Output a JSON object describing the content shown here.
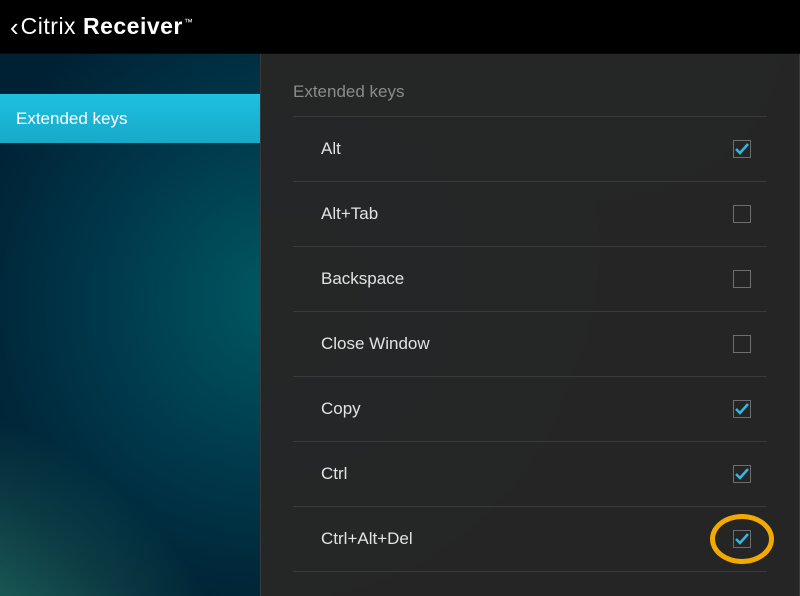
{
  "topbar": {
    "brand_light": "Citrix ",
    "brand_heavy": "Receiver",
    "trademark": "™"
  },
  "sidebar": {
    "items": [
      {
        "label": "Extended keys",
        "active": true
      }
    ]
  },
  "panel": {
    "section_title": "Extended keys",
    "rows": [
      {
        "label": "Alt",
        "checked": true
      },
      {
        "label": "Alt+Tab",
        "checked": false
      },
      {
        "label": "Backspace",
        "checked": false
      },
      {
        "label": "Close Window",
        "checked": false
      },
      {
        "label": "Copy",
        "checked": true
      },
      {
        "label": "Ctrl",
        "checked": true
      },
      {
        "label": "Ctrl+Alt+Del",
        "checked": true
      }
    ]
  },
  "annotation": {
    "highlight_row_index": 6
  },
  "colors": {
    "accent": "#1fc0e0",
    "check": "#35b7df",
    "highlight": "#f2a900"
  }
}
